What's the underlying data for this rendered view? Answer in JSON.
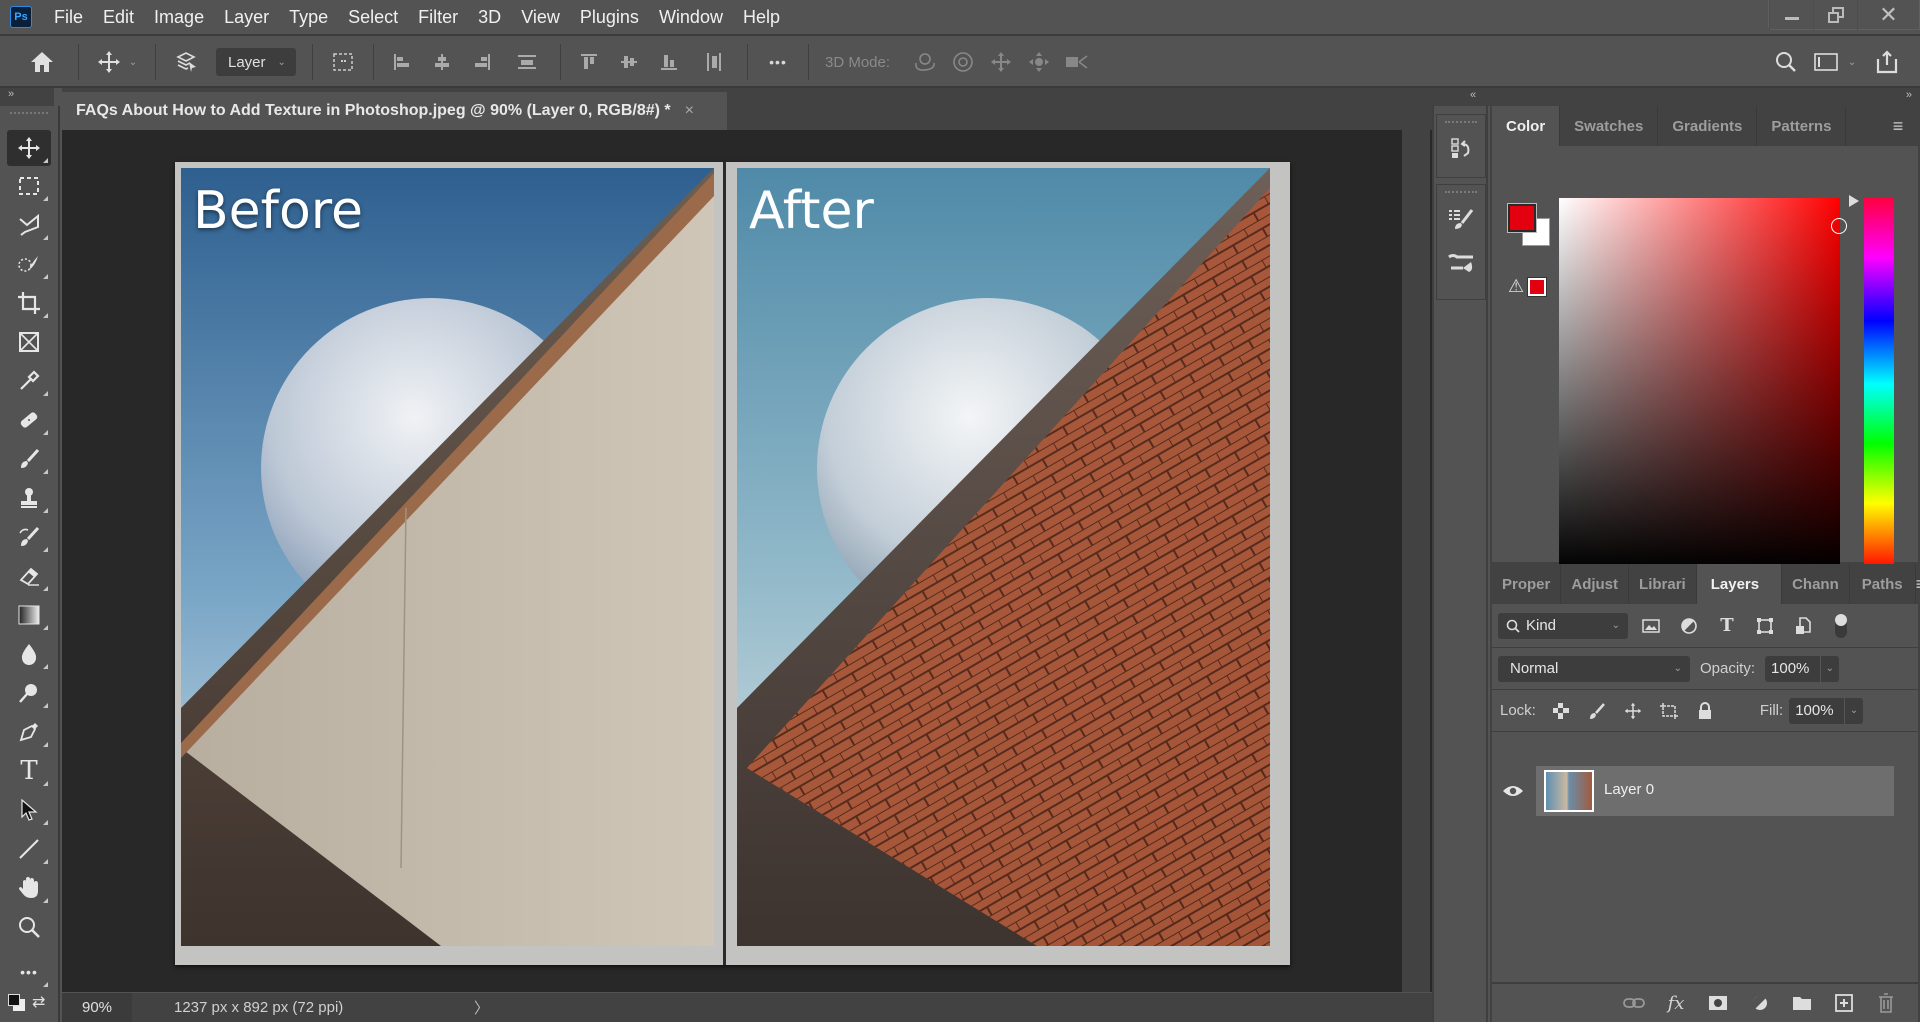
{
  "app": {
    "logo": "Ps"
  },
  "menu": [
    "File",
    "Edit",
    "Image",
    "Layer",
    "Type",
    "Select",
    "Filter",
    "3D",
    "View",
    "Plugins",
    "Window",
    "Help"
  ],
  "window_controls": {
    "minimize": "minimize-icon",
    "restore": "restore-icon",
    "close": "close-icon"
  },
  "options_bar": {
    "auto_select_target": "Layer",
    "three_d_mode_label": "3D Mode:",
    "more_label": "•••"
  },
  "document_tab": {
    "title": "FAQs About How to Add Texture in Photoshop.jpeg @ 90% (Layer 0, RGB/8#) *",
    "close": "×"
  },
  "canvas": {
    "before_label": "Before",
    "after_label": "After"
  },
  "status_bar": {
    "zoom": "90%",
    "doc_info": "1237 px x 892 px (72 ppi)",
    "arrow": "〉"
  },
  "tools": [
    "move",
    "rectangular-marquee",
    "lasso",
    "object-selection",
    "crop",
    "frame",
    "eyedropper",
    "spot-healing",
    "brush",
    "clone-stamp",
    "history-brush",
    "eraser",
    "gradient",
    "blur",
    "dodge",
    "pen",
    "type",
    "path-selection",
    "line",
    "hand",
    "zoom",
    "edit-toolbar"
  ],
  "color_panel": {
    "tabs": [
      "Color",
      "Swatches",
      "Gradients",
      "Patterns"
    ],
    "active_tab": "Color",
    "foreground_color": "#e3000f",
    "background_color": "#ffffff"
  },
  "layers_panel": {
    "tabs": [
      "Proper",
      "Adjust",
      "Librari",
      "Layers",
      "Chann",
      "Paths"
    ],
    "active_tab": "Layers",
    "filter_kind": "Kind",
    "blend_mode": "Normal",
    "opacity_label": "Opacity:",
    "opacity": "100%",
    "lock_label": "Lock:",
    "fill_label": "Fill:",
    "fill": "100%",
    "layers": [
      {
        "name": "Layer 0",
        "visible": true,
        "selected": true
      }
    ]
  }
}
